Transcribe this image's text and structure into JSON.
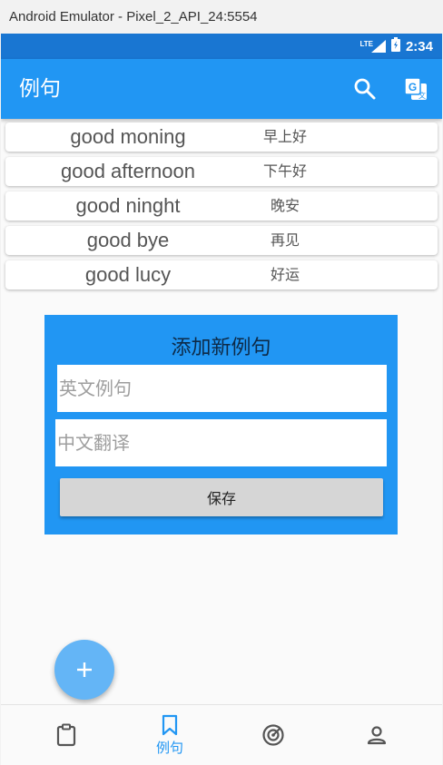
{
  "window": {
    "title": "Android Emulator - Pixel_2_API_24:5554"
  },
  "status_bar": {
    "network": "LTE",
    "time": "2:34"
  },
  "app_bar": {
    "title": "例句",
    "actions": [
      {
        "icon": "search-icon"
      },
      {
        "icon": "translate-icon"
      }
    ]
  },
  "sentences": [
    {
      "en": "good moning",
      "zh": "早上好"
    },
    {
      "en": "good afternoon",
      "zh": "下午好"
    },
    {
      "en": "good ninght",
      "zh": "晚安"
    },
    {
      "en": "good bye",
      "zh": "再见"
    },
    {
      "en": "good lucy",
      "zh": "好运"
    }
  ],
  "add_form": {
    "title": "添加新例句",
    "english_placeholder": "英文例句",
    "chinese_placeholder": "中文翻译",
    "english_value": "",
    "chinese_value": "",
    "save_label": "保存"
  },
  "fab": {
    "icon": "plus-icon"
  },
  "bottom_nav": {
    "items": [
      {
        "icon": "clipboard-icon",
        "label": ""
      },
      {
        "icon": "bookmark-icon",
        "label": "例句",
        "active": true
      },
      {
        "icon": "radar-icon",
        "label": ""
      },
      {
        "icon": "person-icon",
        "label": ""
      }
    ]
  },
  "colors": {
    "primary": "#2196F3",
    "primary_dark": "#1976D2",
    "fab": "#64B5F6",
    "inactive_icon": "#555555"
  }
}
